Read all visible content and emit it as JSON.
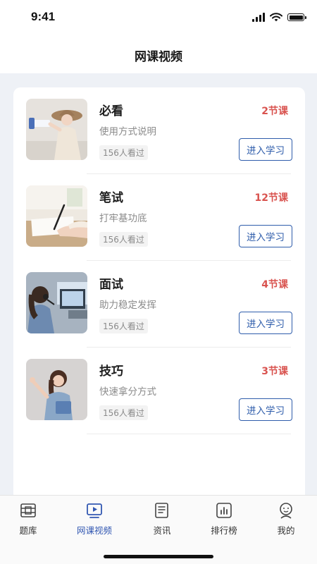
{
  "status_bar": {
    "time": "9:41"
  },
  "nav": {
    "title": "网课视频"
  },
  "courses": [
    {
      "title": "必看",
      "desc": "使用方式说明",
      "views": "156人看过",
      "lessons": "2节课",
      "button": "进入学习"
    },
    {
      "title": "笔试",
      "desc": "打牢基功底",
      "views": "156人看过",
      "lessons": "12节课",
      "button": "进入学习"
    },
    {
      "title": "面试",
      "desc": "助力稳定发挥",
      "views": "156人看过",
      "lessons": "4节课",
      "button": "进入学习"
    },
    {
      "title": "技巧",
      "desc": "快速拿分方式",
      "views": "156人看过",
      "lessons": "3节课",
      "button": "进入学习"
    }
  ],
  "tabs": [
    {
      "label": "题库",
      "icon": "question-bank-icon",
      "active": false
    },
    {
      "label": "网课视频",
      "icon": "video-icon",
      "active": true
    },
    {
      "label": "资讯",
      "icon": "news-icon",
      "active": false
    },
    {
      "label": "排行榜",
      "icon": "ranking-icon",
      "active": false
    },
    {
      "label": "我的",
      "icon": "profile-icon",
      "active": false
    }
  ],
  "colors": {
    "accent": "#3358b2",
    "lessons_red": "#d9534f",
    "button_border": "#2f5dab",
    "page_bg": "#eef1f6"
  }
}
